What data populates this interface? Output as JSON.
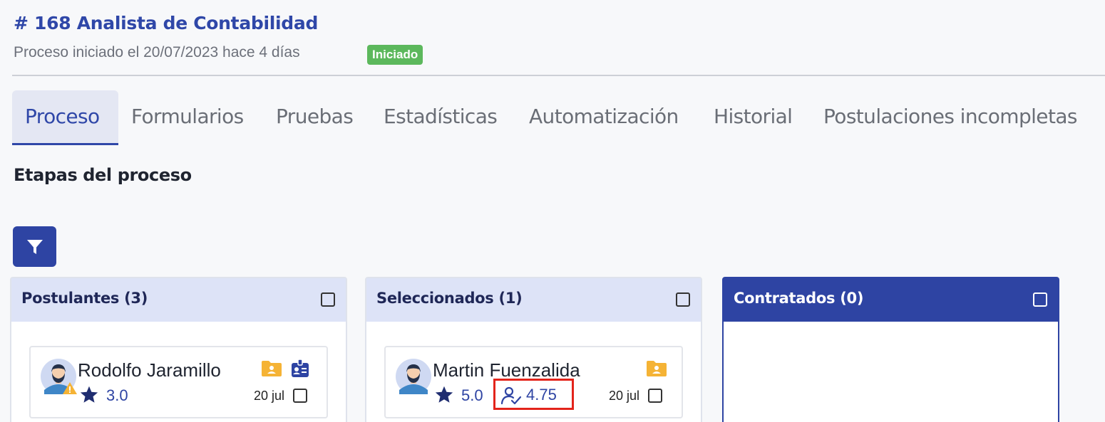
{
  "header": {
    "title": "# 168 Analista de Contabilidad",
    "subtitle": "Proceso iniciado el 20/07/2023 hace 4 días",
    "status_badge": "Iniciado"
  },
  "tabs": [
    {
      "label": "Proceso",
      "active": true
    },
    {
      "label": "Formularios"
    },
    {
      "label": "Pruebas"
    },
    {
      "label": "Estadísticas"
    },
    {
      "label": "Automatización"
    },
    {
      "label": "Historial"
    },
    {
      "label": "Postulaciones incompletas"
    }
  ],
  "section_title": "Etapas del proceso",
  "icons": {
    "filter": "filter-icon",
    "star": "star-icon",
    "folder": "folder-user-icon",
    "id_card": "id-card-icon",
    "warning": "warning-icon",
    "score": "user-check-icon"
  },
  "colors": {
    "primary": "#2e44a3",
    "badge_green": "#5cb85c",
    "folder_orange": "#f5b335",
    "highlight_red": "#e3241b"
  },
  "columns": [
    {
      "title": "Postulantes (3)",
      "cards": [
        {
          "name": "Rodolfo Jaramillo",
          "rating": "3.0",
          "date": "20 jul"
        }
      ]
    },
    {
      "title": "Seleccionados (1)",
      "cards": [
        {
          "name": "Martin Fuenzalida",
          "rating": "5.0",
          "score": "4.75",
          "date": "20 jul"
        }
      ]
    },
    {
      "title": "Contratados (0)",
      "cards": []
    }
  ]
}
